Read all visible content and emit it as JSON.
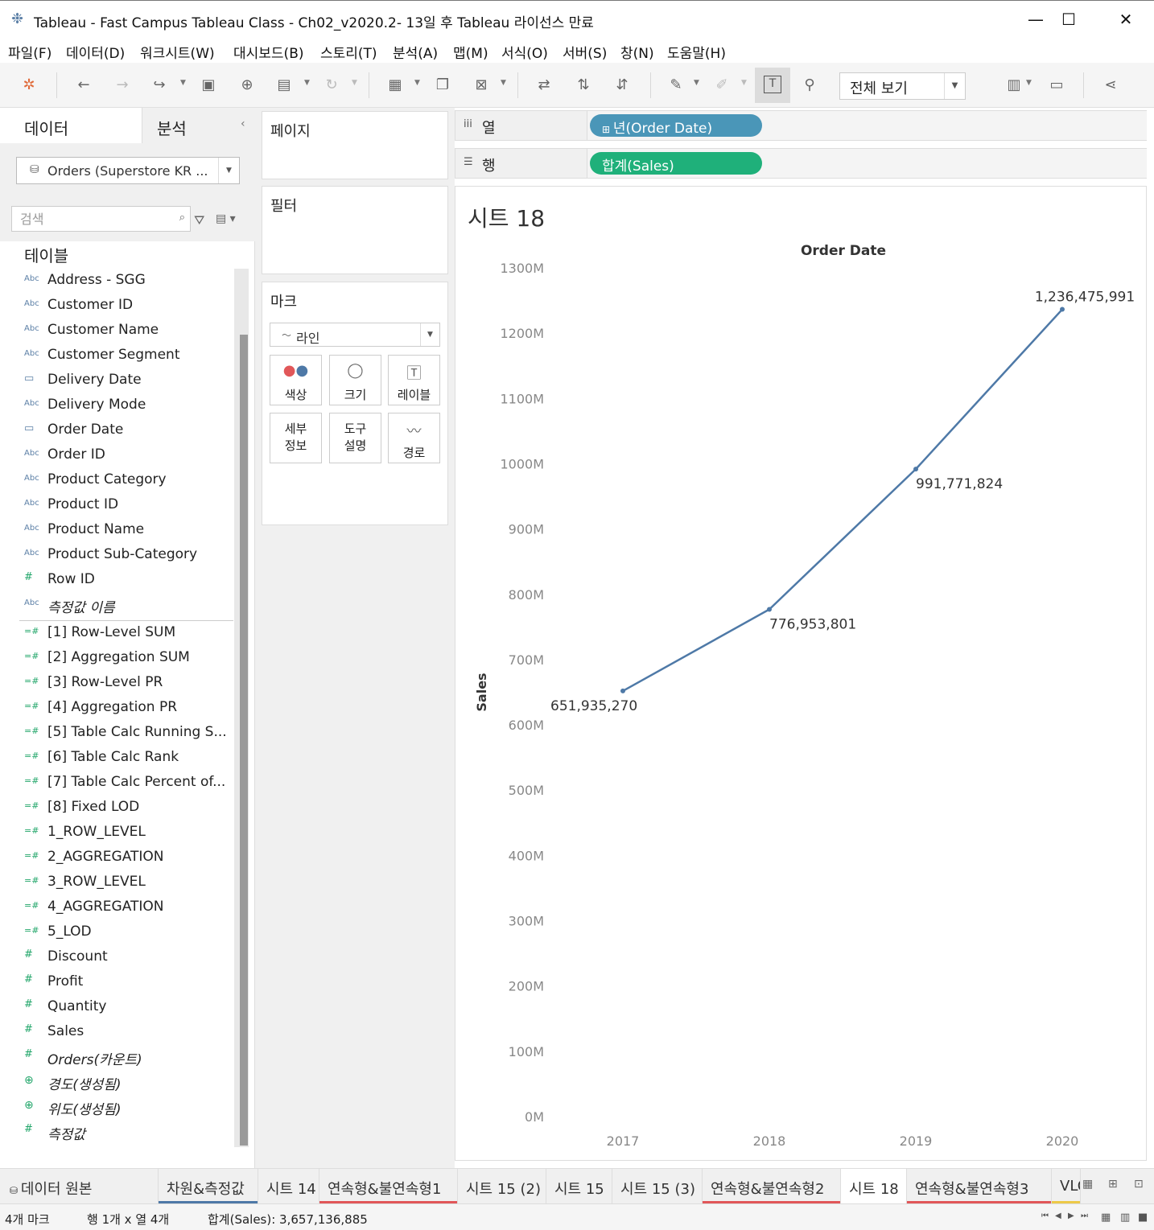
{
  "window": {
    "title": "Tableau - Fast Campus Tableau Class - Ch02_v2020.2- 13일 후 Tableau 라이선스 만료",
    "minimize": "—",
    "maximize": "☐",
    "close": "✕"
  },
  "menu": [
    "파일(F)",
    "데이터(D)",
    "워크시트(W)",
    "대시보드(B)",
    "스토리(T)",
    "분석(A)",
    "맵(M)",
    "서식(O)",
    "서버(S)",
    "창(N)",
    "도움말(H)"
  ],
  "toolbar": {
    "fit_label": "전체 보기"
  },
  "data_pane": {
    "tab_data": "데이터",
    "tab_analysis": "분석",
    "datasource": "Orders (Superstore KR ...",
    "search_placeholder": "검색",
    "tables_header": "테이블",
    "dimensions": [
      {
        "type": "Abc",
        "name": "Address - SGG"
      },
      {
        "type": "Abc",
        "name": "Customer ID"
      },
      {
        "type": "Abc",
        "name": "Customer Name"
      },
      {
        "type": "Abc",
        "name": "Customer Segment"
      },
      {
        "type": "date",
        "name": "Delivery Date"
      },
      {
        "type": "Abc",
        "name": "Delivery Mode"
      },
      {
        "type": "date",
        "name": "Order Date"
      },
      {
        "type": "Abc",
        "name": "Order ID"
      },
      {
        "type": "Abc",
        "name": "Product Category"
      },
      {
        "type": "Abc",
        "name": "Product ID"
      },
      {
        "type": "Abc",
        "name": "Product Name"
      },
      {
        "type": "Abc",
        "name": "Product Sub-Category"
      },
      {
        "type": "num",
        "name": "Row ID"
      },
      {
        "type": "Abc",
        "name": "측정값 이름"
      }
    ],
    "measures": [
      {
        "type": "calc",
        "name": "[1] Row-Level SUM"
      },
      {
        "type": "calc",
        "name": "[2] Aggregation SUM"
      },
      {
        "type": "calc",
        "name": "[3] Row-Level PR"
      },
      {
        "type": "calc",
        "name": "[4] Aggregation PR"
      },
      {
        "type": "calc",
        "name": "[5] Table Calc Running S..."
      },
      {
        "type": "calc",
        "name": "[6] Table Calc Rank"
      },
      {
        "type": "calc",
        "name": "[7] Table Calc Percent of..."
      },
      {
        "type": "calc",
        "name": "[8] Fixed LOD"
      },
      {
        "type": "calc",
        "name": "1_ROW_LEVEL"
      },
      {
        "type": "calc",
        "name": "2_AGGREGATION"
      },
      {
        "type": "calc",
        "name": "3_ROW_LEVEL"
      },
      {
        "type": "calc",
        "name": "4_AGGREGATION"
      },
      {
        "type": "calc",
        "name": "5_LOD"
      },
      {
        "type": "num",
        "name": "Discount"
      },
      {
        "type": "num",
        "name": "Profit"
      },
      {
        "type": "num",
        "name": "Quantity"
      },
      {
        "type": "num",
        "name": "Sales"
      },
      {
        "type": "num",
        "name": "Orders(카운트)"
      },
      {
        "type": "geo",
        "name": "경도(생성됨)"
      },
      {
        "type": "geo",
        "name": "위도(생성됨)"
      },
      {
        "type": "num",
        "name": "측정값"
      }
    ]
  },
  "shelves": {
    "pages": "페이지",
    "filters": "필터",
    "marks": "마크",
    "mark_type": "라인",
    "mark_buttons": {
      "color": "색상",
      "size": "크기",
      "label": "레이블",
      "detail": "세부\n정보",
      "tooltip": "도구\n설명",
      "path": "경로"
    },
    "columns_label": "열",
    "rows_label": "행",
    "columns_pill": "년(Order Date)",
    "rows_pill": "합계(Sales)"
  },
  "sheet": {
    "title": "시트 18"
  },
  "chart_data": {
    "type": "line",
    "title": "Order Date",
    "xlabel": "Order Date",
    "ylabel": "Sales",
    "x": [
      "2017",
      "2018",
      "2019",
      "2020"
    ],
    "values": [
      651935270,
      776953801,
      991771824,
      1236475991
    ],
    "data_labels": [
      "651,935,270",
      "776,953,801",
      "991,771,824",
      "1,236,475,991"
    ],
    "ylim": [
      0,
      1300000000
    ],
    "yticks": [
      "0M",
      "100M",
      "200M",
      "300M",
      "400M",
      "500M",
      "600M",
      "700M",
      "800M",
      "900M",
      "1000M",
      "1100M",
      "1200M",
      "1300M"
    ],
    "line_color": "#4e79a7",
    "grid": false
  },
  "sheet_tabs": {
    "datasource_tab": "데이터 원본",
    "tabs": [
      {
        "label": "차원&측정값",
        "bar": "#4e79a7"
      },
      {
        "label": "시트 14",
        "bar": ""
      },
      {
        "label": "연속형&불연속형1",
        "bar": "#e15759"
      },
      {
        "label": "시트 15 (2)",
        "bar": ""
      },
      {
        "label": "시트 15",
        "bar": ""
      },
      {
        "label": "시트 15 (3)",
        "bar": ""
      },
      {
        "label": "연속형&불연속형2",
        "bar": "#e15759"
      },
      {
        "label": "시트 18",
        "bar": "",
        "active": true
      },
      {
        "label": "연속형&불연속형3",
        "bar": "#e15759"
      },
      {
        "label": "VLO",
        "bar": "#edc948"
      }
    ]
  },
  "status": {
    "marks": "4개 마크",
    "rows_cols": "행 1개 x 열 4개",
    "sum": "합계(Sales): 3,657,136,885"
  }
}
